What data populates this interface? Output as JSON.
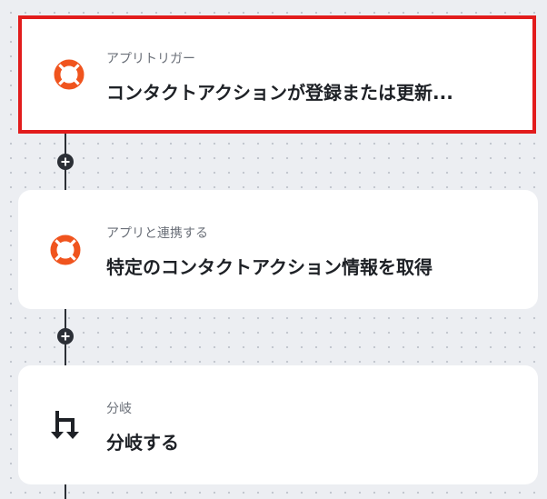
{
  "flow": {
    "steps": [
      {
        "category": "アプリトリガー",
        "title": "コンタクトアクションが登録または更新...",
        "icon": "lifebuoy-icon",
        "selected": true
      },
      {
        "category": "アプリと連携する",
        "title": "特定のコンタクトアクション情報を取得",
        "icon": "lifebuoy-icon",
        "selected": false
      },
      {
        "category": "分岐",
        "title": "分岐する",
        "icon": "branch-icon",
        "selected": false
      }
    ],
    "colors": {
      "selected_border": "#e21c1c",
      "lifebuoy_icon": "#f0541e",
      "connector": "#2b2f36"
    }
  }
}
